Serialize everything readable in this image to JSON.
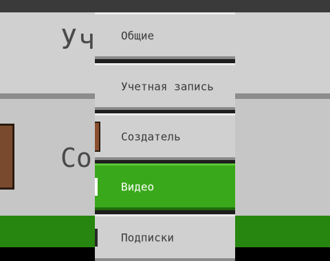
{
  "background": {
    "title_fragment": "Уч            пись",
    "row_fragment": "Со"
  },
  "menu": {
    "items": [
      {
        "label": "Общие",
        "selected": false
      },
      {
        "label": "Учетная запись",
        "selected": false
      },
      {
        "label": "Создатель",
        "selected": false
      },
      {
        "label": "Видео",
        "selected": true
      },
      {
        "label": "Подписки",
        "selected": false
      }
    ]
  },
  "colors": {
    "selected_bg": "#3aa81b",
    "item_bg": "#d0d0d0",
    "text": "#3b3b3b"
  },
  "icons": {
    "creator_item": "portrait-icon",
    "video_item": "video-indicator-icon",
    "subs_item": "subscription-icon"
  }
}
